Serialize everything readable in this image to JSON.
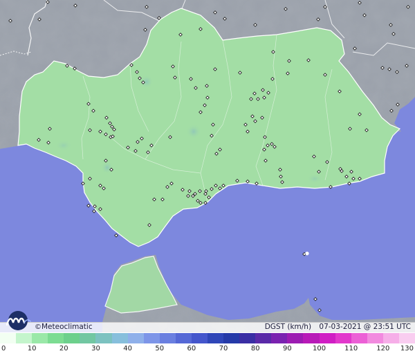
{
  "brand": {
    "copyright": "©",
    "name": "Meteoclimatic",
    "logo_icon": "meteoclimatic-logo-icon"
  },
  "meta": {
    "variable": "DGST (km/h)",
    "timestamp": "07-03-2021 @ 23:51 UTC"
  },
  "legend": {
    "min": 0,
    "max": 130,
    "ticks": [
      "0",
      "10",
      "20",
      "30",
      "40",
      "50",
      "60",
      "70",
      "80",
      "90",
      "100",
      "110",
      "120",
      "130"
    ],
    "colors": [
      "#f2fff2",
      "#c4f5cc",
      "#9ae8a8",
      "#7cdc92",
      "#6dd08c",
      "#72c7a2",
      "#7cc2c0",
      "#87bfdc",
      "#8fb0ea",
      "#7d95e8",
      "#6a7fe0",
      "#5568d6",
      "#4456cc",
      "#2f46b8",
      "#253aa8",
      "#3a2ea4",
      "#5a2aa8",
      "#7a22b0",
      "#9c1cb2",
      "#b81ab8",
      "#d01ec4",
      "#e238cc",
      "#ec60d6",
      "#f28adf",
      "#f6aee8",
      "#f9cdf0"
    ]
  },
  "map": {
    "colors": {
      "sea": "#7d88de",
      "land_outside": "#9aa0aa",
      "region": "#a3dea5",
      "region_border": "#ffffff",
      "station_marker": "#222222"
    },
    "stations": [
      [
        69,
        3
      ],
      [
        15,
        30
      ],
      [
        57,
        28
      ],
      [
        109,
        8
      ],
      [
        212,
        10
      ],
      [
        210,
        43
      ],
      [
        230,
        26
      ],
      [
        261,
        50
      ],
      [
        290,
        42
      ],
      [
        311,
        18
      ],
      [
        325,
        27
      ],
      [
        369,
        36
      ],
      [
        413,
        13
      ],
      [
        460,
        28
      ],
      [
        470,
        10
      ],
      [
        520,
        4
      ],
      [
        527,
        22
      ],
      [
        565,
        36
      ],
      [
        569,
        49
      ],
      [
        590,
        10
      ],
      [
        513,
        70
      ],
      [
        553,
        98
      ],
      [
        563,
        100
      ],
      [
        574,
        104
      ],
      [
        588,
        95
      ],
      [
        520,
        165
      ],
      [
        566,
        160
      ],
      [
        575,
        151
      ],
      [
        97,
        95
      ],
      [
        108,
        99
      ],
      [
        190,
        94
      ],
      [
        198,
        104
      ],
      [
        202,
        113
      ],
      [
        207,
        119
      ],
      [
        250,
        96
      ],
      [
        253,
        112
      ],
      [
        276,
        114
      ],
      [
        283,
        127
      ],
      [
        299,
        124
      ],
      [
        300,
        141
      ],
      [
        311,
        100
      ],
      [
        347,
        105
      ],
      [
        395,
        75
      ],
      [
        416,
        106
      ],
      [
        418,
        88
      ],
      [
        446,
        87
      ],
      [
        363,
        143
      ],
      [
        368,
        135
      ],
      [
        373,
        143
      ],
      [
        380,
        130
      ],
      [
        382,
        141
      ],
      [
        388,
        134
      ],
      [
        394,
        114
      ],
      [
        470,
        108
      ],
      [
        491,
        132
      ],
      [
        128,
        150
      ],
      [
        135,
        160
      ],
      [
        154,
        170
      ],
      [
        159,
        178
      ],
      [
        162,
        183
      ],
      [
        145,
        190
      ],
      [
        165,
        187
      ],
      [
        130,
        188
      ],
      [
        72,
        186
      ],
      [
        56,
        202
      ],
      [
        70,
        206
      ],
      [
        153,
        194
      ],
      [
        160,
        198
      ],
      [
        163,
        197
      ],
      [
        199,
        205
      ],
      [
        205,
        200
      ],
      [
        185,
        213
      ],
      [
        214,
        220
      ],
      [
        219,
        210
      ],
      [
        196,
        218
      ],
      [
        246,
        198
      ],
      [
        290,
        162
      ],
      [
        296,
        152
      ],
      [
        308,
        180
      ],
      [
        306,
        196
      ],
      [
        313,
        222
      ],
      [
        318,
        216
      ],
      [
        365,
        168
      ],
      [
        355,
        180
      ],
      [
        358,
        190
      ],
      [
        369,
        175
      ],
      [
        379,
        170
      ],
      [
        383,
        198
      ],
      [
        387,
        210
      ],
      [
        393,
        208
      ],
      [
        397,
        212
      ],
      [
        382,
        216
      ],
      [
        384,
        232
      ],
      [
        405,
        245
      ],
      [
        408,
        263
      ],
      [
        506,
        186
      ],
      [
        530,
        188
      ],
      [
        454,
        226
      ],
      [
        461,
        248
      ],
      [
        473,
        234
      ],
      [
        478,
        270
      ],
      [
        492,
        244
      ],
      [
        494,
        247
      ],
      [
        501,
        255
      ],
      [
        508,
        248
      ],
      [
        511,
        258
      ],
      [
        520,
        258
      ],
      [
        505,
        265
      ],
      [
        153,
        232
      ],
      [
        161,
        245
      ],
      [
        120,
        265
      ],
      [
        130,
        258
      ],
      [
        145,
        268
      ],
      [
        150,
        272
      ],
      [
        128,
        297
      ],
      [
        137,
        298
      ],
      [
        136,
        305
      ],
      [
        145,
        302
      ],
      [
        168,
        340
      ],
      [
        216,
        325
      ],
      [
        223,
        288
      ],
      [
        242,
        270
      ],
      [
        248,
        265
      ],
      [
        235,
        288
      ],
      [
        264,
        274
      ],
      [
        274,
        276
      ],
      [
        272,
        283
      ],
      [
        279,
        283
      ],
      [
        282,
        280
      ],
      [
        289,
        276
      ],
      [
        297,
        280
      ],
      [
        298,
        276
      ],
      [
        302,
        285
      ],
      [
        306,
        273
      ],
      [
        286,
        290
      ],
      [
        290,
        293
      ],
      [
        297,
        293
      ],
      [
        312,
        268
      ],
      [
        318,
        272
      ],
      [
        323,
        268
      ],
      [
        343,
        261
      ],
      [
        358,
        262
      ],
      [
        371,
        265
      ],
      [
        406,
        255
      ],
      [
        456,
        432
      ],
      [
        462,
        448
      ],
      [
        440,
        367
      ]
    ]
  }
}
